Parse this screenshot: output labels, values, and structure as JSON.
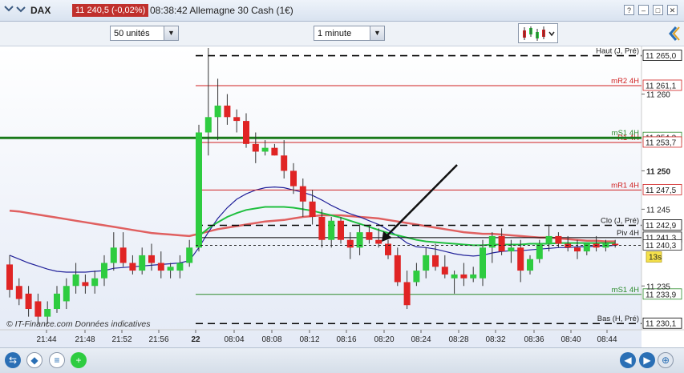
{
  "header": {
    "instrument": "DAX",
    "price": "11 240,5 (-0,02%)",
    "time_title": "08:38:42 Allemagne 30 Cash (1€)"
  },
  "toolbar": {
    "units": "50 unités",
    "interval": "1 minute"
  },
  "chart": {
    "watermark": "© IT-Finance.com  Données indicatives",
    "countdown": "13s",
    "current_price": "11 240,3",
    "last_price_tag": "11 240,5",
    "colors": {
      "up": "#2ecc40",
      "down": "#e02424",
      "ma_red": "#e06060",
      "ma_green": "#1fbf3f",
      "ma_blue": "#22229a"
    }
  },
  "chart_data": {
    "type": "candlestick",
    "x_ticks": [
      "21:44",
      "21:48",
      "21:52",
      "21:56",
      "22",
      "08:04",
      "08:08",
      "08:12",
      "08:16",
      "08:20",
      "08:24",
      "08:28",
      "08:32",
      "08:36",
      "08:40",
      "08:44"
    ],
    "y_ticks": [
      "11 260",
      "11 250",
      "11 245",
      "11 235"
    ],
    "ylim": [
      11229.5,
      11266
    ],
    "reference_lines": [
      {
        "label": "Haut (J, Pré)",
        "value": "11 265,0",
        "v": 11265.0,
        "style": "dash",
        "color": "#000000"
      },
      {
        "label": "mR2 4H",
        "value": "11 261,1",
        "v": 11261.1,
        "style": "solid",
        "color": "#d02020"
      },
      {
        "label": "mS1 4H",
        "value": "11 254,3",
        "v": 11254.3,
        "style": "solid",
        "color": "#2a8a2a"
      },
      {
        "label": "R1 4H",
        "value": "11 253,7",
        "v": 11253.7,
        "style": "solid",
        "color": "#d02020"
      },
      {
        "label": "mR1 4H",
        "value": "11 247,5",
        "v": 11247.5,
        "style": "solid",
        "color": "#d02020"
      },
      {
        "label": "Clo (J, Pré)",
        "value": "11 242,9",
        "v": 11242.9,
        "style": "dash",
        "color": "#000000"
      },
      {
        "label": "Piv 4H",
        "value": "11 241,3",
        "v": 11241.3,
        "style": "solid",
        "color": "#000000"
      },
      {
        "label": "mS1 4H",
        "value": "11 233,9",
        "v": 11233.9,
        "style": "solid",
        "color": "#2a8a2a"
      },
      {
        "label": "Bas (H, Pré)",
        "value": "11 230,1",
        "v": 11230.1,
        "style": "dash",
        "color": "#000000"
      }
    ],
    "candles": [
      [
        11237.8,
        11239.0,
        11233.5,
        11234.5
      ],
      [
        11235.0,
        11236.0,
        11232.5,
        11233.3
      ],
      [
        11234.0,
        11235.0,
        11231.0,
        11232.0
      ],
      [
        11233.0,
        11234.0,
        11230.0,
        11231.0
      ],
      [
        11231.0,
        11233.0,
        11230.0,
        11232.0
      ],
      [
        11232.0,
        11235.0,
        11231.5,
        11234.0
      ],
      [
        11233.0,
        11236.0,
        11232.0,
        11235.0
      ],
      [
        11235.0,
        11238.0,
        11234.0,
        11236.5
      ],
      [
        11235.5,
        11236.5,
        11234.0,
        11235.0
      ],
      [
        11235.0,
        11237.0,
        11234.0,
        11236.0
      ],
      [
        11236.0,
        11239.0,
        11235.0,
        11238.0
      ],
      [
        11238.0,
        11242.0,
        11237.0,
        11240.0
      ],
      [
        11240.0,
        11242.0,
        11237.5,
        11238.0
      ],
      [
        11238.0,
        11239.0,
        11236.5,
        11237.0
      ],
      [
        11237.0,
        11240.0,
        11236.5,
        11239.0
      ],
      [
        11239.0,
        11240.5,
        11237.0,
        11238.0
      ],
      [
        11238.0,
        11239.5,
        11236.0,
        11237.0
      ],
      [
        11237.0,
        11238.0,
        11236.0,
        11237.5
      ],
      [
        11237.0,
        11239.0,
        11236.0,
        11238.0
      ],
      [
        11238.0,
        11241.0,
        11237.5,
        11240.0
      ],
      [
        11240.0,
        11256.0,
        11239.5,
        11255.0
      ],
      [
        11255.0,
        11266.0,
        11252.0,
        11257.0
      ],
      [
        11257.0,
        11262.0,
        11254.0,
        11258.5
      ],
      [
        11258.5,
        11260.0,
        11256.0,
        11257.0
      ],
      [
        11257.0,
        11258.0,
        11255.0,
        11256.5
      ],
      [
        11256.5,
        11257.5,
        11253.0,
        11253.5
      ],
      [
        11253.5,
        11255.0,
        11251.0,
        11252.5
      ],
      [
        11252.5,
        11254.0,
        11252.0,
        11253.0
      ],
      [
        11253.0,
        11253.5,
        11252.0,
        11252.0
      ],
      [
        11252.0,
        11254.0,
        11249.0,
        11250.0
      ],
      [
        11250.0,
        11251.0,
        11247.0,
        11248.0
      ],
      [
        11248.0,
        11249.0,
        11244.0,
        11246.0
      ],
      [
        11246.0,
        11247.5,
        11243.0,
        11244.0
      ],
      [
        11244.0,
        11245.0,
        11240.0,
        11241.0
      ],
      [
        11241.0,
        11244.0,
        11240.0,
        11243.5
      ],
      [
        11243.5,
        11244.0,
        11240.5,
        11241.0
      ],
      [
        11241.0,
        11242.0,
        11238.5,
        11240.0
      ],
      [
        11240.0,
        11243.0,
        11239.0,
        11242.0
      ],
      [
        11242.0,
        11243.0,
        11240.5,
        11241.0
      ],
      [
        11241.0,
        11242.5,
        11240.0,
        11240.5
      ],
      [
        11240.5,
        11241.0,
        11238.5,
        11239.0
      ],
      [
        11239.0,
        11240.0,
        11235.0,
        11235.5
      ],
      [
        11235.5,
        11237.0,
        11232.0,
        11232.5
      ],
      [
        11235.5,
        11238.0,
        11235.0,
        11237.0
      ],
      [
        11237.0,
        11240.0,
        11236.0,
        11239.0
      ],
      [
        11239.0,
        11240.5,
        11237.0,
        11237.5
      ],
      [
        11237.5,
        11239.0,
        11236.0,
        11236.5
      ],
      [
        11236.0,
        11237.0,
        11234.0,
        11236.5
      ],
      [
        11236.5,
        11238.0,
        11235.0,
        11236.0
      ],
      [
        11236.0,
        11237.5,
        11235.5,
        11236.5
      ],
      [
        11236.0,
        11241.0,
        11235.0,
        11240.0
      ],
      [
        11240.0,
        11242.0,
        11238.0,
        11241.5
      ],
      [
        11241.5,
        11242.5,
        11239.0,
        11239.5
      ],
      [
        11239.5,
        11241.0,
        11238.0,
        11240.0
      ],
      [
        11240.0,
        11241.0,
        11235.5,
        11237.0
      ],
      [
        11237.0,
        11239.0,
        11236.5,
        11238.5
      ],
      [
        11238.5,
        11241.0,
        11238.0,
        11240.5
      ],
      [
        11240.5,
        11243.0,
        11239.5,
        11241.5
      ],
      [
        11241.5,
        11242.0,
        11240.0,
        11240.5
      ],
      [
        11240.5,
        11241.5,
        11239.5,
        11240.0
      ],
      [
        11240.0,
        11241.0,
        11238.5,
        11239.5
      ],
      [
        11239.5,
        11240.5,
        11239.0,
        11240.5
      ],
      [
        11240.5,
        11241.5,
        11239.5,
        11240.0
      ],
      [
        11240.0,
        11241.0,
        11239.5,
        11240.5
      ],
      [
        11240.5,
        11241.0,
        11240.0,
        11240.3
      ]
    ],
    "ma_red": [
      11244.8,
      11244.7,
      11244.5,
      11244.3,
      11244.1,
      11243.9,
      11243.7,
      11243.5,
      11243.3,
      11243.1,
      11242.9,
      11242.7,
      11242.5,
      11242.3,
      11242.1,
      11241.9,
      11241.8,
      11241.7,
      11241.6,
      11241.5,
      11241.8,
      11242.1,
      11242.4,
      11242.6,
      11242.8,
      11243.0,
      11243.2,
      11243.4,
      11243.5,
      11243.6,
      11243.8,
      11244.0,
      11244.1,
      11244.2,
      11244.2,
      11244.2,
      11244.1,
      11244.0,
      11243.9,
      11243.8,
      11243.6,
      11243.4,
      11243.2,
      11243.0,
      11242.8,
      11242.6,
      11242.4,
      11242.2,
      11242.0,
      11241.9,
      11241.8,
      11241.8,
      11241.7,
      11241.6,
      11241.5,
      11241.4,
      11241.3,
      11241.3,
      11241.2,
      11241.1,
      11241.0,
      11240.9,
      11240.9,
      11240.8,
      11240.8
    ],
    "ma_green": [
      null,
      null,
      null,
      null,
      null,
      null,
      null,
      null,
      null,
      null,
      null,
      null,
      null,
      null,
      null,
      null,
      null,
      null,
      null,
      null,
      11241.5,
      11242.5,
      11243.3,
      11244.0,
      11244.5,
      11244.9,
      11245.1,
      11245.3,
      11245.3,
      11245.3,
      11245.2,
      11245.0,
      11244.8,
      11244.5,
      11244.2,
      11243.9,
      11243.5,
      11243.1,
      11242.7,
      11242.3,
      11241.9,
      11241.6,
      11241.3,
      11241.0,
      11240.8,
      11240.7,
      11240.6,
      11240.5,
      11240.4,
      11240.3,
      11240.3,
      11240.4,
      11240.4,
      11240.4,
      11240.4,
      11240.5,
      11240.5,
      11240.5,
      11240.6,
      11240.6,
      11240.6,
      11240.6,
      11240.6,
      11240.6,
      11240.6
    ],
    "ma_blue": [
      11239.0,
      11238.5,
      11238.0,
      11237.6,
      11237.2,
      11236.9,
      11236.8,
      11236.8,
      11236.8,
      11236.9,
      11237.0,
      11237.3,
      11237.4,
      11237.5,
      11237.6,
      11237.7,
      11237.8,
      11237.9,
      11238.0,
      11238.3,
      11240.0,
      11242.0,
      11243.8,
      11245.2,
      11246.3,
      11247.0,
      11247.5,
      11247.8,
      11247.9,
      11247.8,
      11247.5,
      11247.2,
      11246.8,
      11246.2,
      11245.5,
      11244.9,
      11244.4,
      11244.0,
      11243.5,
      11243.0,
      11242.3,
      11241.5,
      11240.6,
      11240.1,
      11240.0,
      11239.8,
      11239.5,
      11239.2,
      11239.0,
      11238.9,
      11239.0,
      11239.3,
      11239.5,
      11239.6,
      11239.6,
      11239.7,
      11239.8,
      11239.9,
      11240.0,
      11240.0,
      11240.1,
      11240.1,
      11240.2,
      11240.2,
      11240.3
    ]
  }
}
